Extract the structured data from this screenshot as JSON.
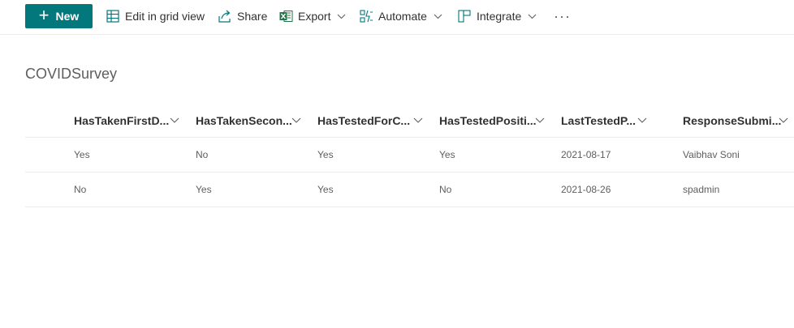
{
  "toolbar": {
    "new_label": "New",
    "edit_grid_label": "Edit in grid view",
    "share_label": "Share",
    "export_label": "Export",
    "automate_label": "Automate",
    "integrate_label": "Integrate",
    "more_label": "···"
  },
  "list": {
    "title": "COVIDSurvey",
    "columns": [
      "HasTakenFirstD...",
      "HasTakenSecon...",
      "HasTestedForC...",
      "HasTestedPositi...",
      "LastTestedP...",
      "ResponseSubmi..."
    ],
    "rows": [
      [
        "Yes",
        "No",
        "Yes",
        "Yes",
        "2021-08-17",
        "Vaibhav Soni"
      ],
      [
        "No",
        "Yes",
        "Yes",
        "No",
        "2021-08-26",
        "spadmin"
      ]
    ]
  },
  "colors": {
    "accent": "#03787c",
    "excel_green": "#217346",
    "divider": "#edebe9"
  }
}
